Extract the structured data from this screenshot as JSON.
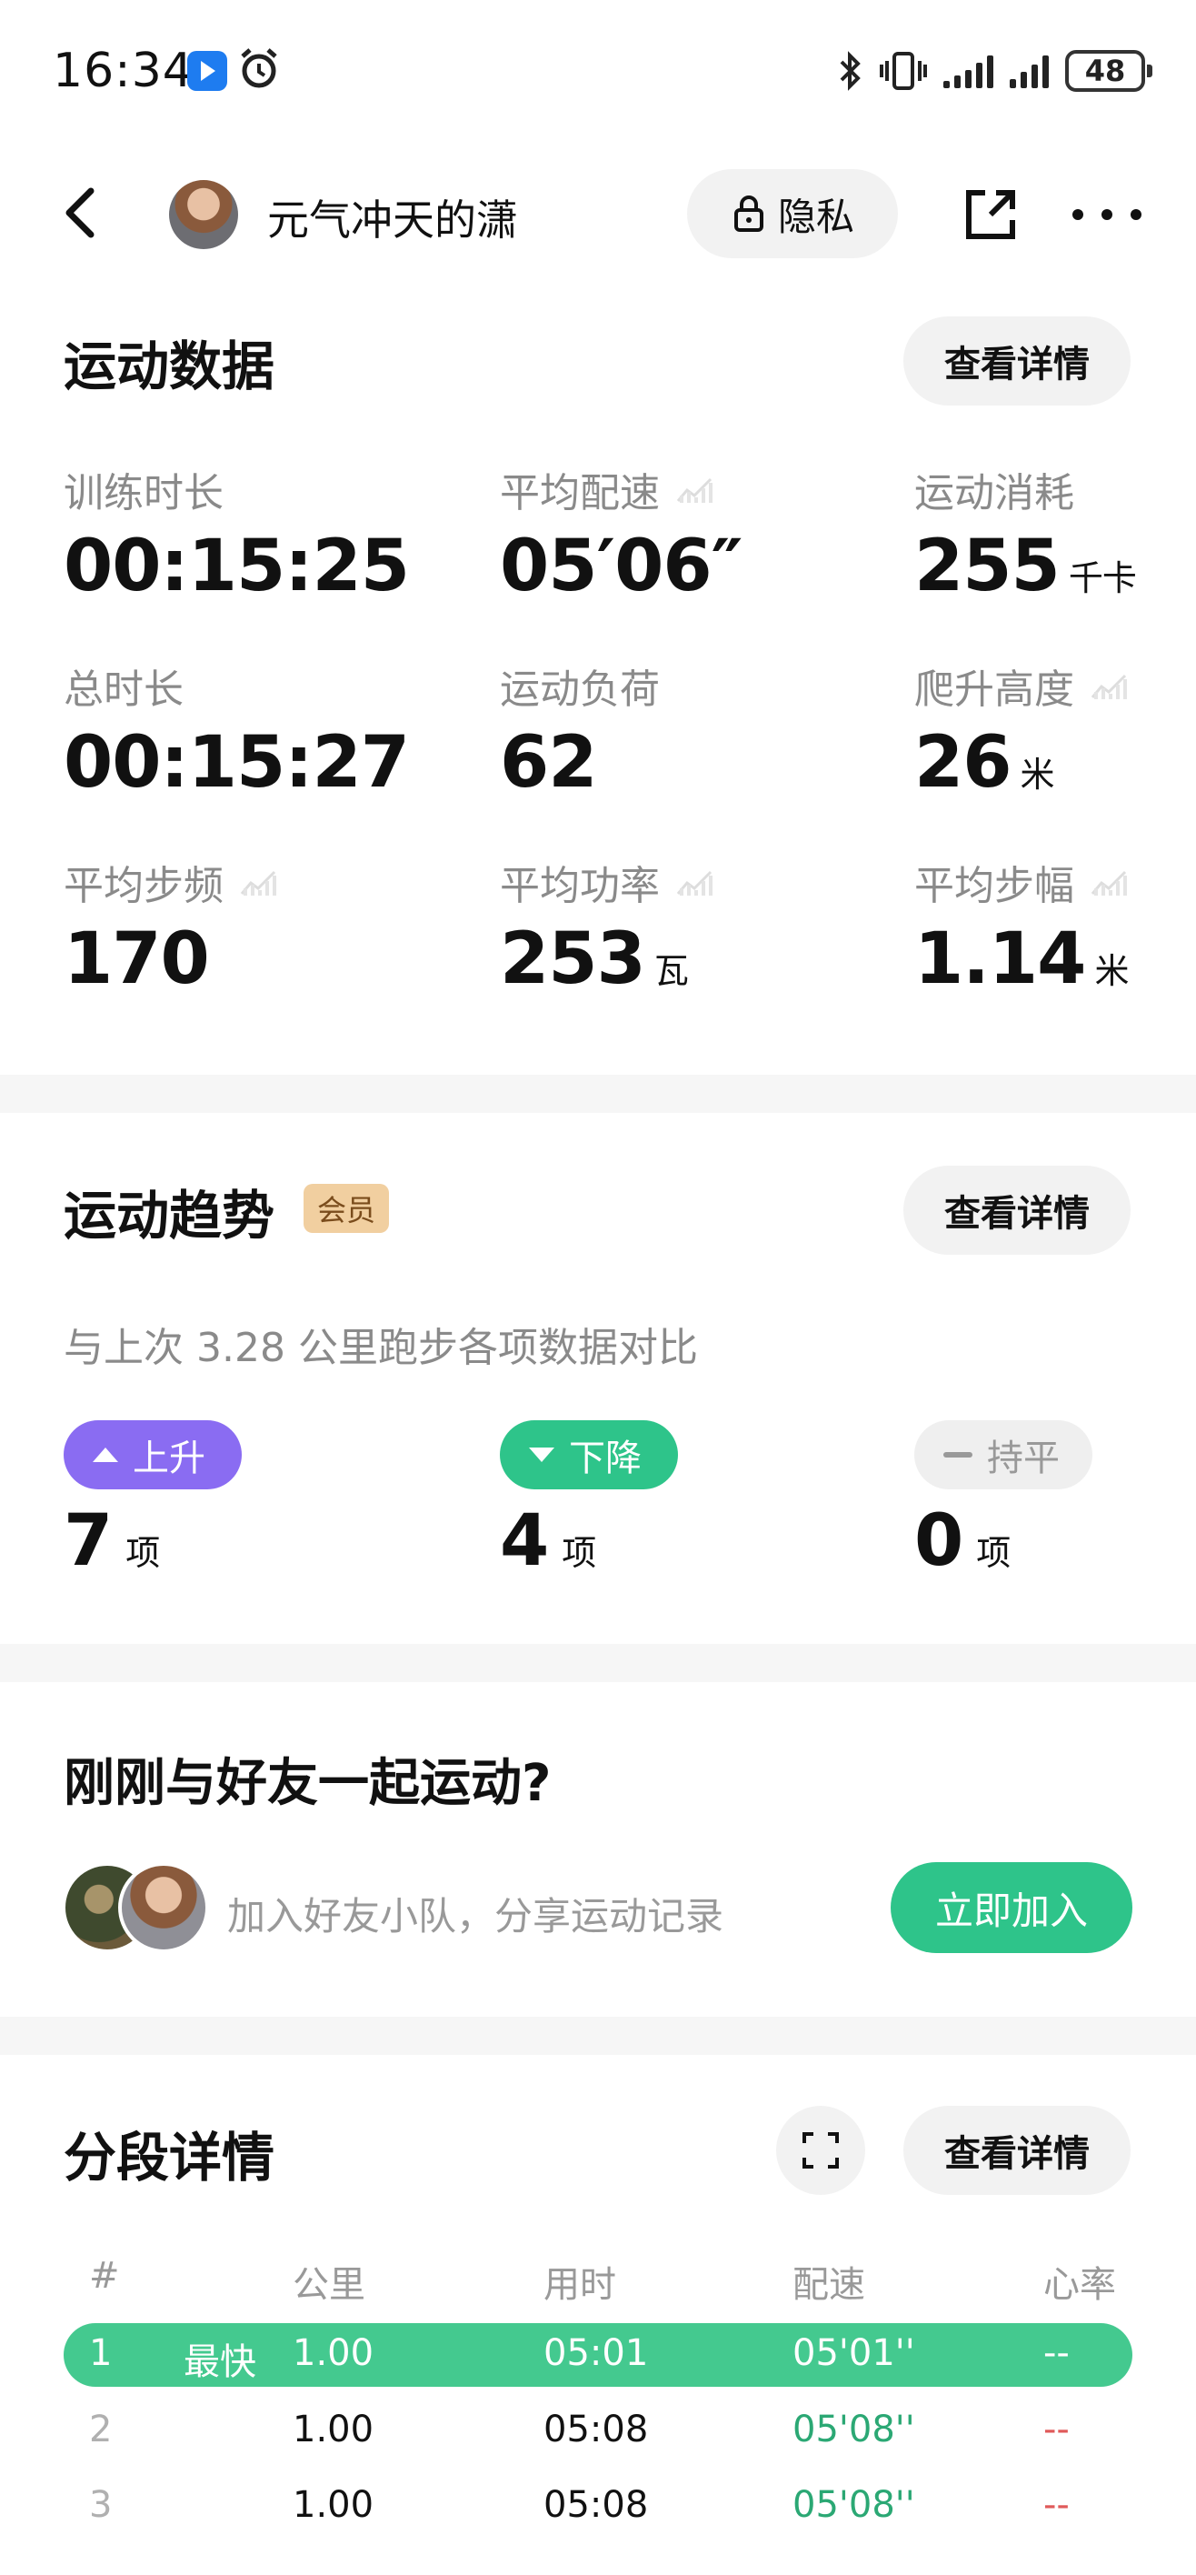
{
  "status_bar": {
    "time": "16:34",
    "battery": "48",
    "icons": [
      "app-icon",
      "alarm-icon",
      "bluetooth-icon",
      "vibrate-icon",
      "signal-icon",
      "signal-icon",
      "battery-icon"
    ]
  },
  "header": {
    "username": "元气冲天的潇",
    "privacy_label": "隐私"
  },
  "sport_data": {
    "title": "运动数据",
    "detail_label": "查看详情",
    "metrics": [
      {
        "label": "训练时长",
        "value": "00:15:25",
        "unit": ""
      },
      {
        "label": "平均配速",
        "value": "05′06″",
        "unit": ""
      },
      {
        "label": "运动消耗",
        "value": "255",
        "unit": "千卡"
      },
      {
        "label": "总时长",
        "value": "00:15:27",
        "unit": ""
      },
      {
        "label": "运动负荷",
        "value": "62",
        "unit": ""
      },
      {
        "label": "爬升高度",
        "value": "26",
        "unit": "米"
      },
      {
        "label": "平均步频",
        "value": "170",
        "unit": ""
      },
      {
        "label": "平均功率",
        "value": "253",
        "unit": "瓦"
      },
      {
        "label": "平均步幅",
        "value": "1.14",
        "unit": "米"
      }
    ]
  },
  "trend": {
    "title": "运动趋势",
    "badge": "会员",
    "detail_label": "查看详情",
    "description": "与上次 3.28 公里跑步各项数据对比",
    "up": {
      "label": "上升",
      "count": "7",
      "unit": "项"
    },
    "down": {
      "label": "下降",
      "count": "4",
      "unit": "项"
    },
    "flat": {
      "label": "持平",
      "count": "0",
      "unit": "项"
    }
  },
  "friends": {
    "title": "刚刚与好友一起运动?",
    "text": "加入好友小队，分享运动记录",
    "join_label": "立即加入"
  },
  "segments": {
    "title": "分段详情",
    "detail_label": "查看详情",
    "columns": [
      "#",
      "公里",
      "用时",
      "配速",
      "心率"
    ],
    "fastest_label": "最快",
    "rows": [
      {
        "index": "1",
        "km": "1.00",
        "time": "05:01",
        "pace": "05'01''",
        "hr": "--",
        "fastest": true
      },
      {
        "index": "2",
        "km": "1.00",
        "time": "05:08",
        "pace": "05'08''",
        "hr": "--",
        "fastest": false
      },
      {
        "index": "3",
        "km": "1.00",
        "time": "05:08",
        "pace": "05'08''",
        "hr": "--",
        "fastest": false
      }
    ]
  },
  "colors": {
    "accent_green": "#2ec48a",
    "up_purple": "#8a6cf2",
    "vip_gold": "#f1cfa0",
    "hr_red": "#e05a5a"
  }
}
